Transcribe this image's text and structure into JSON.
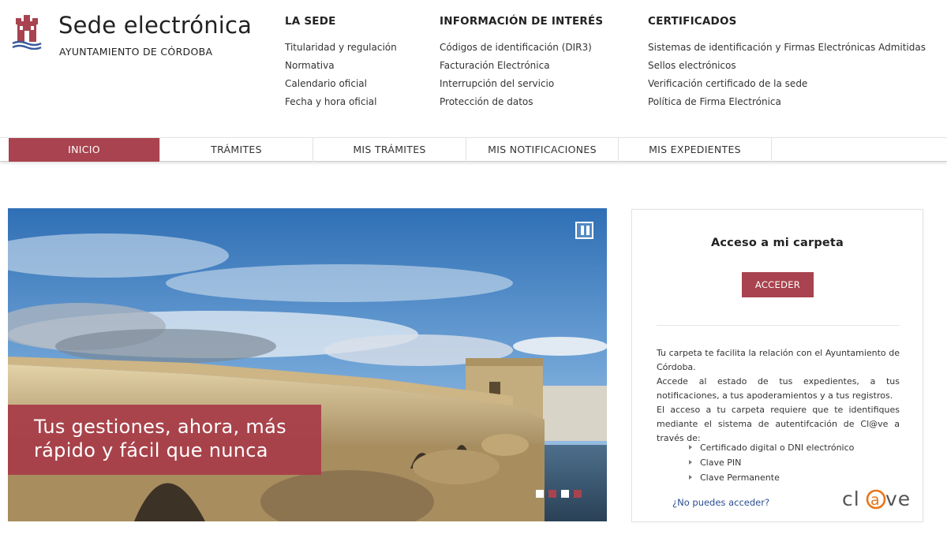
{
  "site": {
    "title": "Sede electrónica",
    "subtitle": "AYUNTAMIENTO DE CÓRDOBA"
  },
  "header_columns": [
    {
      "heading": "LA SEDE",
      "links": [
        "Titularidad y regulación",
        "Normativa",
        "Calendario oficial",
        "Fecha y hora oficial"
      ]
    },
    {
      "heading": "INFORMACIÓN DE INTERÉS",
      "links": [
        "Códigos de identificación (DIR3)",
        "Facturación Electrónica",
        "Interrupción del servicio",
        "Protección de datos"
      ]
    },
    {
      "heading": "CERTIFICADOS",
      "links": [
        "Sistemas de identificación y Firmas Electrónicas Admitidas",
        "Sellos electrónicos",
        "Verificación certificado de la sede",
        "Política de Firma Electrónica"
      ]
    }
  ],
  "nav": {
    "items": [
      "INICIO",
      "TRÁMITES",
      "MIS TRÁMITES",
      "MIS NOTIFICACIONES",
      "MIS EXPEDIENTES"
    ],
    "active": "INICIO"
  },
  "hero": {
    "slogan_line1": "Tus gestiones, ahora, más",
    "slogan_line2": "rápido y fácil que nunca",
    "slide_count": 4,
    "active_slide": 2
  },
  "panel": {
    "title": "Acceso a mi carpeta",
    "button": "ACCEDER",
    "paragraphs": [
      "Tu carpeta te facilita la relación con el Ayuntamiento de Córdoba.",
      "Accede al estado de tus expedientes, a tus notificaciones, a tus apoderamientos y a tus registros.",
      "El acceso a tu carpeta requiere que te identifiques mediante el sistema de autentifcación de Cl@ve a través de:"
    ],
    "methods": [
      "Certificado digital o DNI electrónico",
      "Clave PIN",
      "Clave Permanente"
    ],
    "help_link": "¿No puedes acceder?",
    "logo_text": "cl@ve"
  },
  "colors": {
    "accent": "#a8434f",
    "link": "#2b4d8f"
  }
}
